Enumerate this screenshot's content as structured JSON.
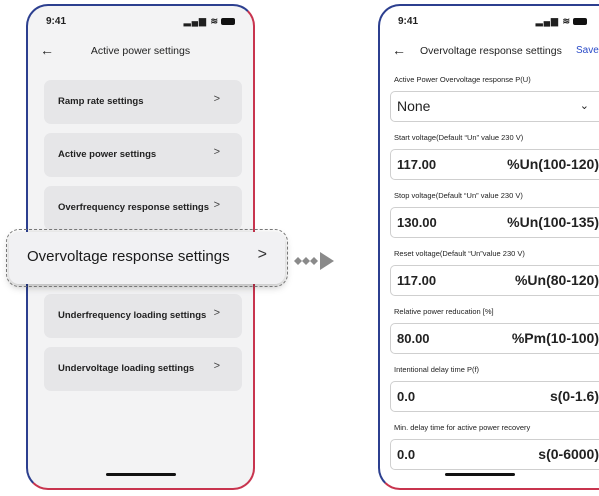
{
  "left_phone": {
    "status": {
      "time": "9:41",
      "signal": "▂▄▆",
      "wifi": "≋"
    },
    "header": {
      "title": "Active power settings"
    },
    "menu": [
      {
        "label": "Ramp rate settings"
      },
      {
        "label": "Active power settings"
      },
      {
        "label": "Overfrequency response settings"
      },
      {
        "label": "Underfrequency loading settings"
      },
      {
        "label": "Undervoltage loading settings"
      }
    ],
    "highlighted_item": {
      "label": "Overvoltage response settings"
    }
  },
  "right_phone": {
    "status": {
      "time": "9:41",
      "signal": "▂▄▆",
      "wifi": "≋"
    },
    "header": {
      "title": "Overvoltage response settings",
      "save": "Save"
    },
    "mode": {
      "label": "Active Power Overvoltage response P(U)",
      "value": "None"
    },
    "fields": [
      {
        "label": "Start voltage(Default “Un” value 230 V)",
        "value": "117.00",
        "unit": "%Un(100-120)"
      },
      {
        "label": "Stop voltage(Default “Un” value 230 V)",
        "value": "130.00",
        "unit": "%Un(100-135)"
      },
      {
        "label": "Reset voltage(Default “Un”value 230 V)",
        "value": "117.00",
        "unit": "%Un(80-120)"
      },
      {
        "label": "Relative power reducation [%]",
        "value": "80.00",
        "unit": "%Pm(10-100)"
      },
      {
        "label": "Intentional delay time P(f)",
        "value": "0.0",
        "unit": "s(0-1.6)"
      },
      {
        "label": "Min. delay time for active power recovery",
        "value": "0.0",
        "unit": "s(0-6000)"
      }
    ]
  },
  "colors": {
    "frame_blue": "#2c3f8f",
    "frame_red": "#c8344e",
    "save_blue": "#2a4bc8"
  }
}
